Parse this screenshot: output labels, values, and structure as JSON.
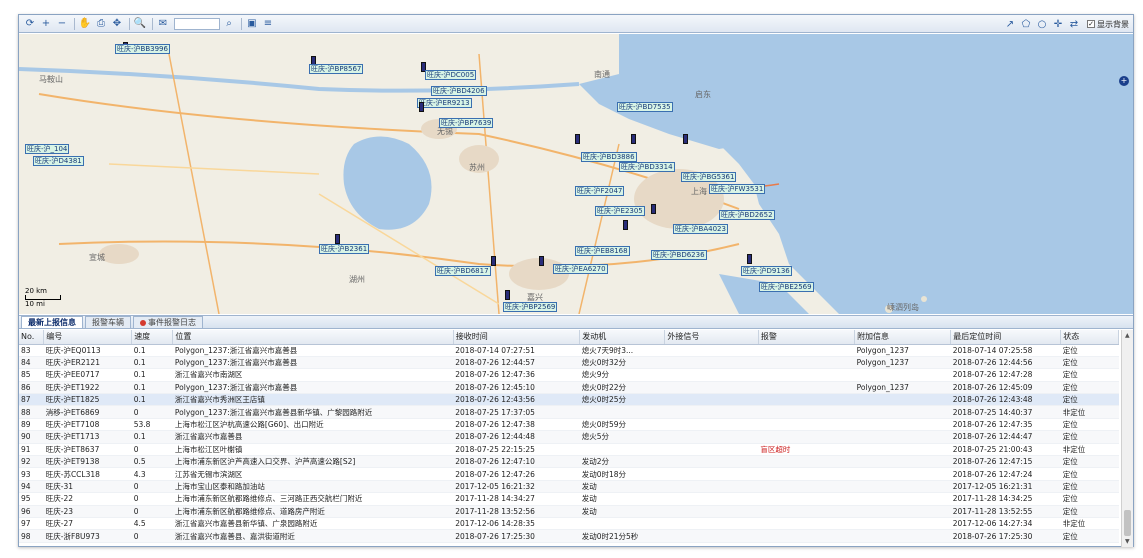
{
  "toolbar": {
    "search_placeholder": "",
    "show_label": "显示背景"
  },
  "map": {
    "places": [
      "马鞍山",
      "无锡",
      "苏州",
      "上海",
      "宣城",
      "湖州",
      "嘉兴",
      "启东",
      "南通",
      "嵊泗列岛"
    ],
    "scale_km": "20 km",
    "scale_mi": "10 mi",
    "vehicles": [
      "旺庆-沪BB3996",
      "旺庆-沪BP8567",
      "旺庆-沪DC005",
      "旺庆-沪BD4206",
      "旺庆-沪ER9213",
      "旺庆-沪BP7639",
      "旺庆-沪BD7535",
      "旺庆-沪_104",
      "旺庆-沪D4381",
      "旺庆-沪BD3886",
      "旺庆-沪BD3314",
      "旺庆-沪F2047",
      "旺庆-沪BG5361",
      "旺庆-沪FW3531",
      "旺庆-沪E2305",
      "旺庆-沪BA4023",
      "旺庆-沪BD2652",
      "旺庆-沪EB8168",
      "旺庆-沪BD6236",
      "旺庆-沪B2361",
      "旺庆-沪BD6817",
      "旺庆-沪EA6270",
      "旺庆-沪D9136",
      "旺庆-沪BP2569",
      "旺庆-沪BE2569"
    ]
  },
  "tabs": [
    {
      "label": "最新上报信息",
      "active": true
    },
    {
      "label": "报警车辆",
      "active": false
    },
    {
      "label": "事件报警日志",
      "active": false
    }
  ],
  "table": {
    "columns": [
      "No.",
      "编号",
      "速度",
      "位置",
      "接收时间",
      "发动机",
      "外接信号",
      "报警",
      "附加信息",
      "最后定位时间",
      "状态"
    ],
    "rows": [
      [
        "83",
        "旺庆-沪EQ0113",
        "0.1",
        "Polygon_1237:浙江省嘉兴市嘉善县",
        "2018-07-14 07:27:51",
        "熄火7天9时3...",
        "",
        "",
        "Polygon_1237",
        "2018-07-14 07:25:58",
        "定位"
      ],
      [
        "84",
        "旺庆-沪ER2121",
        "0.1",
        "Polygon_1237:浙江省嘉兴市嘉善县",
        "2018-07-26 12:44:57",
        "熄火0时32分",
        "",
        "",
        "Polygon_1237",
        "2018-07-26 12:44:56",
        "定位"
      ],
      [
        "85",
        "旺庆-沪EE0717",
        "0.1",
        "浙江省嘉兴市南湖区",
        "2018-07-26 12:47:36",
        "熄火9分",
        "",
        "",
        "",
        "2018-07-26 12:47:28",
        "定位"
      ],
      [
        "86",
        "旺庆-沪ET1922",
        "0.1",
        "Polygon_1237:浙江省嘉兴市嘉善县",
        "2018-07-26 12:45:10",
        "熄火0时22分",
        "",
        "",
        "Polygon_1237",
        "2018-07-26 12:45:09",
        "定位"
      ],
      [
        "87",
        "旺庆-沪ET1825",
        "0.1",
        "浙江省嘉兴市秀洲区王店镇",
        "2018-07-26 12:43:56",
        "熄火0时25分",
        "",
        "",
        "",
        "2018-07-26 12:43:48",
        "定位"
      ],
      [
        "88",
        "消移-沪ET6869",
        "0",
        "Polygon_1237:浙江省嘉兴市嘉善县新华镇、广黎园路附近",
        "2018-07-25 17:37:05",
        "",
        "",
        "",
        "",
        "2018-07-25 14:40:37",
        "非定位"
      ],
      [
        "89",
        "旺庆-沪ET7108",
        "53.8",
        "上海市松江区沪杭高速公路[G60]、出口附近",
        "2018-07-26 12:47:38",
        "熄火0时59分",
        "",
        "",
        "",
        "2018-07-26 12:47:35",
        "定位"
      ],
      [
        "90",
        "旺庆-沪ET1713",
        "0.1",
        "浙江省嘉兴市嘉善县",
        "2018-07-26 12:44:48",
        "熄火5分",
        "",
        "",
        "",
        "2018-07-26 12:44:47",
        "定位"
      ],
      [
        "91",
        "旺庆-沪ET8637",
        "0",
        "上海市松江区叶榭镇",
        "2018-07-25 22:15:25",
        "",
        "",
        "盲区超时",
        "",
        "2018-07-25 21:00:43",
        "非定位"
      ],
      [
        "92",
        "旺庆-沪ET9138",
        "0.5",
        "上海市浦东新区沪芦高速入口交界、沪芦高速公路[S2]",
        "2018-07-26 12:47:10",
        "发动2分",
        "",
        "",
        "",
        "2018-07-26 12:47:15",
        "定位"
      ],
      [
        "93",
        "旺庆-苏CCL318",
        "4.3",
        "江苏省无锡市滨湖区",
        "2018-07-26 12:47:26",
        "发动0时18分",
        "",
        "",
        "",
        "2018-07-26 12:47:24",
        "定位"
      ],
      [
        "94",
        "旺庆-31",
        "0",
        "上海市宝山区泰和路加油站",
        "2017-12-05 16:21:32",
        "发动",
        "",
        "",
        "",
        "2017-12-05 16:21:31",
        "定位"
      ],
      [
        "95",
        "旺庆-22",
        "0",
        "上海市浦东新区航都路维修点、三河路正西交航栏门附近",
        "2017-11-28 14:34:27",
        "发动",
        "",
        "",
        "",
        "2017-11-28 14:34:25",
        "定位"
      ],
      [
        "96",
        "旺庆-23",
        "0",
        "上海市浦东新区航都路维修点、道路房产附近",
        "2017-11-28 13:52:56",
        "发动",
        "",
        "",
        "",
        "2017-11-28 13:52:55",
        "定位"
      ],
      [
        "97",
        "旺庆-27",
        "4.5",
        "浙江省嘉兴市嘉善县新华镇、广泉园路附近",
        "2017-12-06 14:28:35",
        "",
        "",
        "",
        "",
        "2017-12-06 14:27:34",
        "非定位"
      ],
      [
        "98",
        "旺庆-浙F8U973",
        "0",
        "浙江省嘉兴市嘉善县、嘉洪街道附近",
        "2018-07-26 17:25:30",
        "发动0时21分5秒",
        "",
        "",
        "",
        "2018-07-26 17:25:30",
        "定位"
      ]
    ]
  }
}
